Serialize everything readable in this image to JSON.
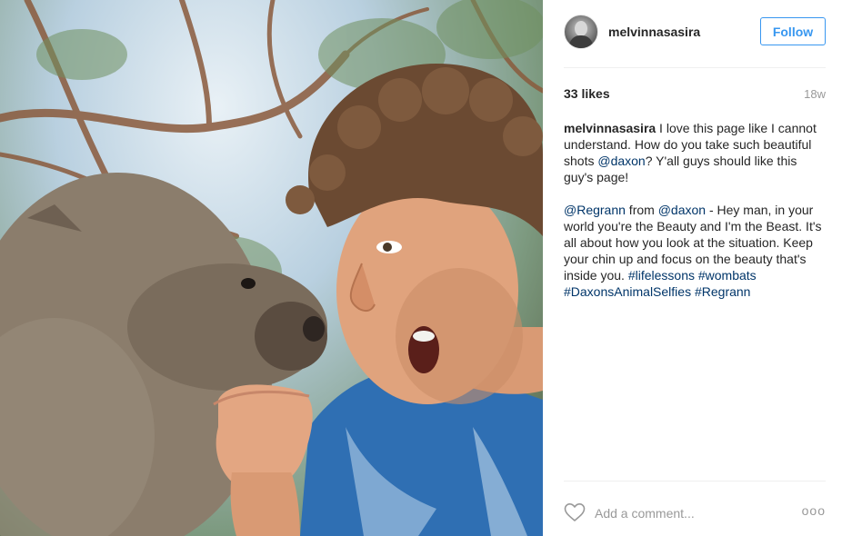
{
  "post": {
    "username": "melvinnasasira",
    "follow_label": "Follow",
    "likes": "33 likes",
    "time": "18w",
    "caption_user": "melvinnasasira",
    "caption_p1_a": " I love this page like I cannot understand. How do you take such beautiful shots ",
    "caption_p1_mention": "@daxon",
    "caption_p1_b": "? Y'all guys should like this guy's page!",
    "caption_p2_mention1": "@Regrann",
    "caption_p2_a": " from ",
    "caption_p2_mention2": "@daxon",
    "caption_p2_b": " - Hey man, in your world you're the Beauty and I'm the Beast. It's all about how you look at the situation. Keep your chin up and focus on the beauty that's inside you. ",
    "hashtags": [
      "#lifelessons",
      "#wombats",
      "#DaxonsAnimalSelfies",
      "#Regrann"
    ],
    "comment_placeholder": "Add a comment...",
    "more_label": "ooo"
  },
  "icons": {
    "like": "heart-outline-icon",
    "more": "more-dots-icon"
  },
  "colors": {
    "link": "#003569",
    "follow": "#3897f0",
    "muted": "#999999"
  }
}
